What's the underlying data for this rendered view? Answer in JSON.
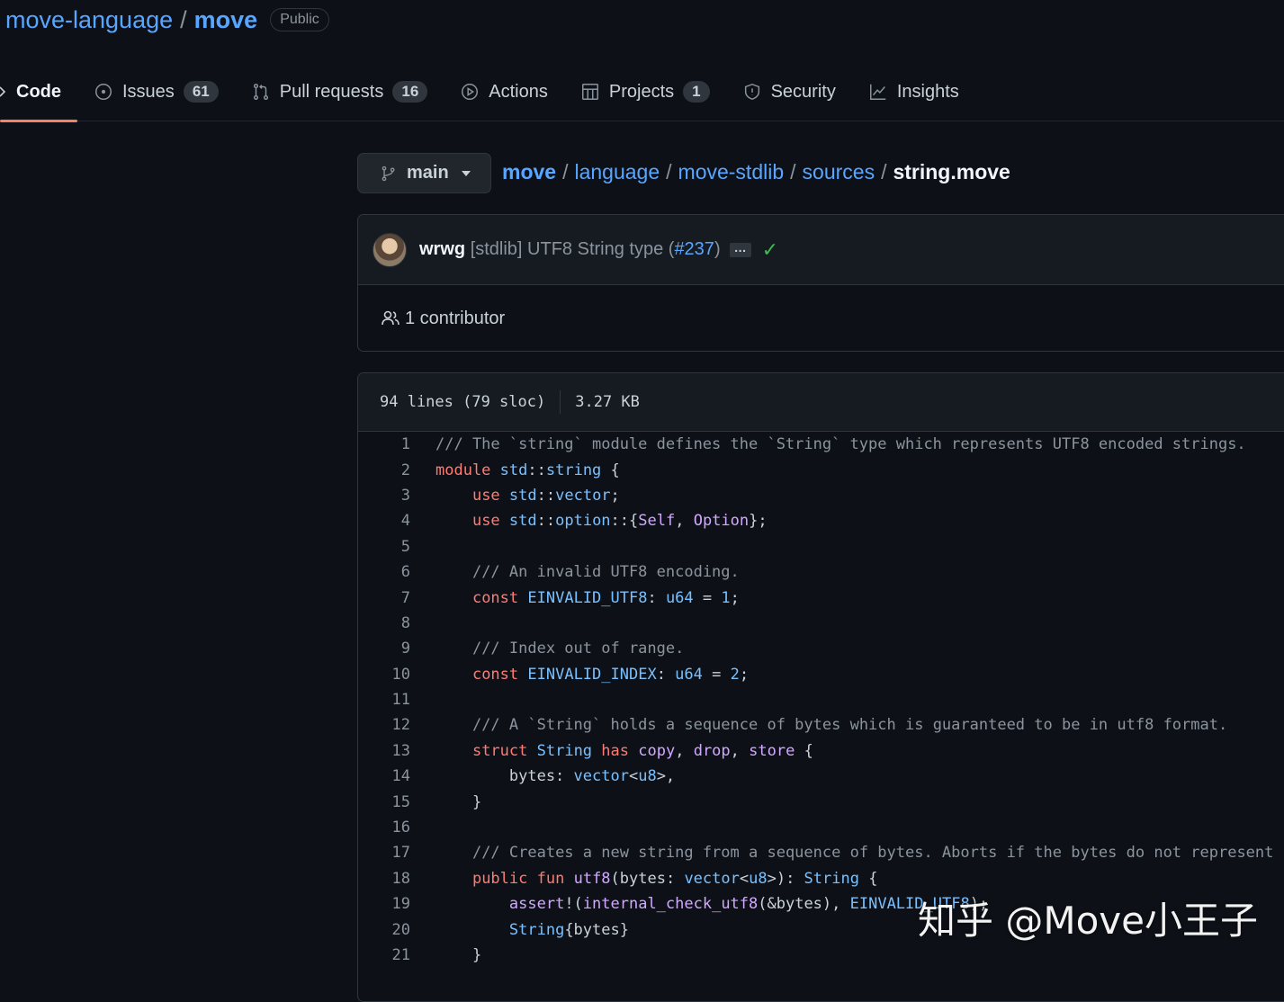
{
  "repo": {
    "owner": "move-language",
    "separator": "/",
    "name": "move",
    "visibility": "Public"
  },
  "tabs": [
    {
      "label": "Code",
      "icon": "code-icon",
      "active": true
    },
    {
      "label": "Issues",
      "icon": "issue-icon",
      "count": "61"
    },
    {
      "label": "Pull requests",
      "icon": "pull-request-icon",
      "count": "16"
    },
    {
      "label": "Actions",
      "icon": "play-icon"
    },
    {
      "label": "Projects",
      "icon": "table-icon",
      "count": "1"
    },
    {
      "label": "Security",
      "icon": "shield-icon"
    },
    {
      "label": "Insights",
      "icon": "graph-icon"
    }
  ],
  "branch": {
    "label": "main"
  },
  "breadcrumb": {
    "root": "move",
    "parts": [
      "language",
      "move-stdlib",
      "sources"
    ],
    "file": "string.move",
    "sep": "/"
  },
  "commit": {
    "author": "wrwg",
    "message": "[stdlib] UTF8 String type (",
    "pr": "#237",
    "message_end": ")",
    "ellipsis": "…",
    "status": "✓"
  },
  "contributors": {
    "label": "1 contributor"
  },
  "file": {
    "lines": "94 lines (79 sloc)",
    "size": "3.27 KB"
  },
  "code_lines": [
    "/// The `string` module defines the `String` type which represents UTF8 encoded strings.",
    "module std::string {",
    "    use std::vector;",
    "    use std::option::{Self, Option};",
    "",
    "    /// An invalid UTF8 encoding.",
    "    const EINVALID_UTF8: u64 = 1;",
    "",
    "    /// Index out of range.",
    "    const EINVALID_INDEX: u64 = 2;",
    "",
    "    /// A `String` holds a sequence of bytes which is guaranteed to be in utf8 format.",
    "    struct String has copy, drop, store {",
    "        bytes: vector<u8>,",
    "    }",
    "",
    "    /// Creates a new string from a sequence of bytes. Aborts if the bytes do not represent",
    "    public fun utf8(bytes: vector<u8>): String {",
    "        assert!(internal_check_utf8(&bytes), EINVALID_UTF8);",
    "        String{bytes}",
    "    }"
  ],
  "watermark": "知乎 @Move小王子"
}
